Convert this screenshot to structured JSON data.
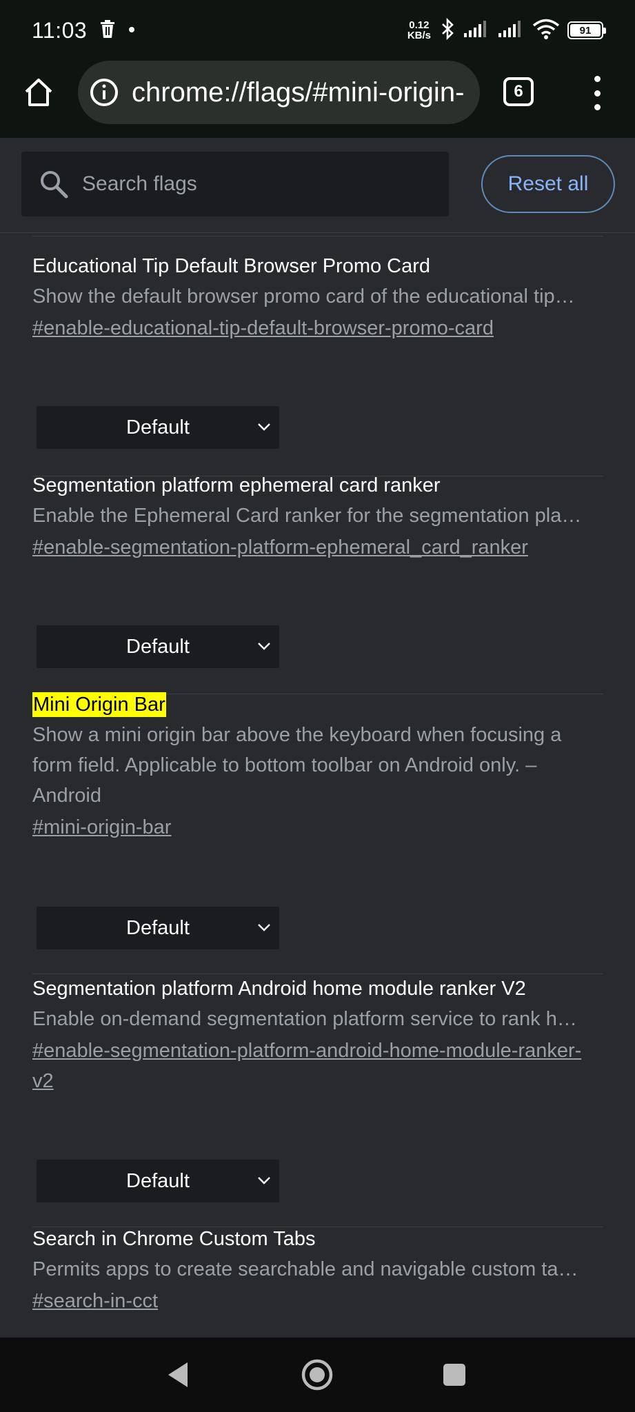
{
  "status_bar": {
    "time": "11:03",
    "net_speed_value": "0.12",
    "net_speed_unit": "KB/s",
    "battery": "91",
    "icons": [
      "trash-icon",
      "dot-icon",
      "bluetooth-icon",
      "signal-icon",
      "signal-icon",
      "wifi-icon",
      "battery-icon"
    ]
  },
  "toolbar": {
    "url": "chrome://flags/#mini-origin-",
    "tab_count": "6",
    "icons": [
      "home-icon",
      "info-icon",
      "tab-switcher-icon",
      "more-vert-icon"
    ]
  },
  "search": {
    "placeholder": "Search flags",
    "reset_label": "Reset all"
  },
  "flags": [
    {
      "title": "Educational Tip Default Browser Promo Card",
      "description": "Show the default browser promo card of the educational tip…",
      "link": "#enable-educational-tip-default-browser-promo-card",
      "value": "Default"
    },
    {
      "title": "Segmentation platform ephemeral card ranker",
      "description": "Enable the Ephemeral Card ranker for the segmentation pla…",
      "link": "#enable-segmentation-platform-ephemeral_card_ranker",
      "value": "Default"
    },
    {
      "title": "Mini Origin Bar",
      "description": "Show a mini origin bar above the keyboard when focusing a form field. Applicable to bottom toolbar on Android only. – Android",
      "link": "#mini-origin-bar",
      "value": "Default",
      "highlighted": true
    },
    {
      "title": "Segmentation platform Android home module ranker V2",
      "description": "Enable on-demand segmentation platform service to rank h…",
      "link": "#enable-segmentation-platform-android-home-module-ranker-v2",
      "value": "Default"
    },
    {
      "title": "Search in Chrome Custom Tabs",
      "description": "Permits apps to create searchable and navigable custom ta…",
      "link": "#search-in-cct"
    }
  ],
  "colors": {
    "background": "#292a2d",
    "toolbar": "#0e1410",
    "accent": "#8ab4f8",
    "highlight": "#ffff00"
  }
}
